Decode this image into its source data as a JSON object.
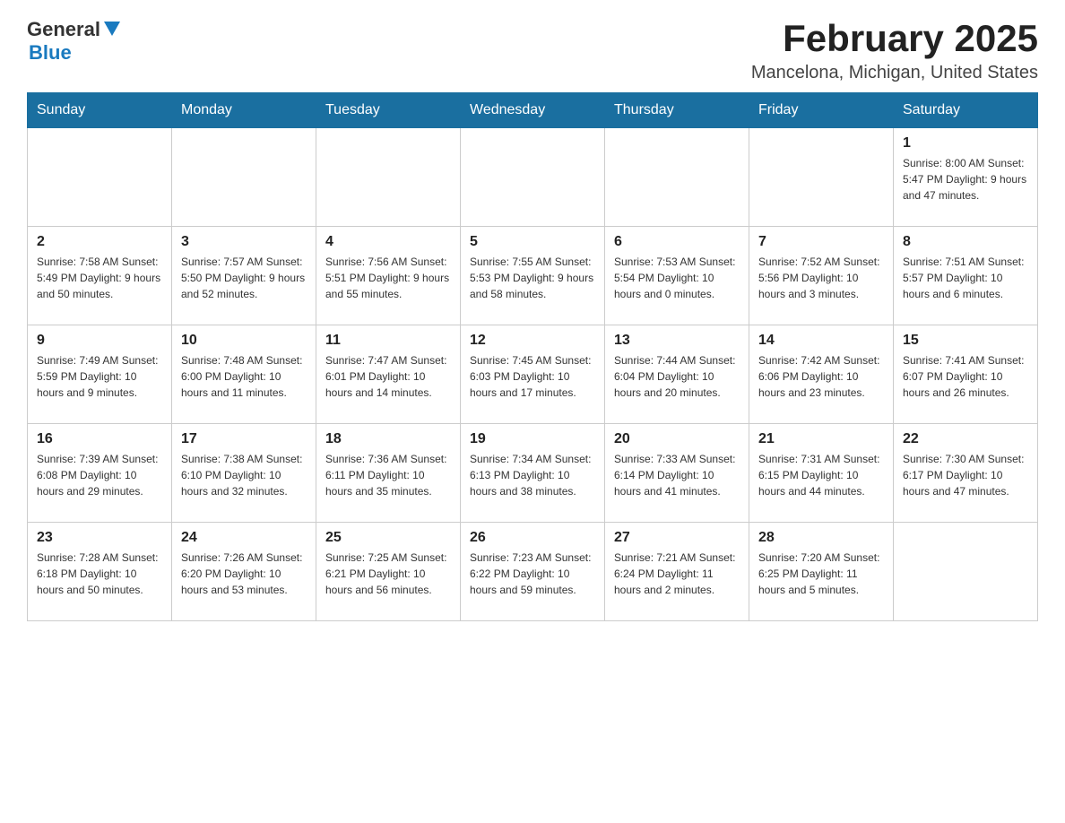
{
  "header": {
    "logo": {
      "general": "General",
      "blue": "Blue"
    },
    "title": "February 2025",
    "location": "Mancelona, Michigan, United States"
  },
  "days_of_week": [
    "Sunday",
    "Monday",
    "Tuesday",
    "Wednesday",
    "Thursday",
    "Friday",
    "Saturday"
  ],
  "weeks": [
    {
      "days": [
        {
          "date": "",
          "info": ""
        },
        {
          "date": "",
          "info": ""
        },
        {
          "date": "",
          "info": ""
        },
        {
          "date": "",
          "info": ""
        },
        {
          "date": "",
          "info": ""
        },
        {
          "date": "",
          "info": ""
        },
        {
          "date": "1",
          "info": "Sunrise: 8:00 AM\nSunset: 5:47 PM\nDaylight: 9 hours and 47 minutes."
        }
      ]
    },
    {
      "days": [
        {
          "date": "2",
          "info": "Sunrise: 7:58 AM\nSunset: 5:49 PM\nDaylight: 9 hours and 50 minutes."
        },
        {
          "date": "3",
          "info": "Sunrise: 7:57 AM\nSunset: 5:50 PM\nDaylight: 9 hours and 52 minutes."
        },
        {
          "date": "4",
          "info": "Sunrise: 7:56 AM\nSunset: 5:51 PM\nDaylight: 9 hours and 55 minutes."
        },
        {
          "date": "5",
          "info": "Sunrise: 7:55 AM\nSunset: 5:53 PM\nDaylight: 9 hours and 58 minutes."
        },
        {
          "date": "6",
          "info": "Sunrise: 7:53 AM\nSunset: 5:54 PM\nDaylight: 10 hours and 0 minutes."
        },
        {
          "date": "7",
          "info": "Sunrise: 7:52 AM\nSunset: 5:56 PM\nDaylight: 10 hours and 3 minutes."
        },
        {
          "date": "8",
          "info": "Sunrise: 7:51 AM\nSunset: 5:57 PM\nDaylight: 10 hours and 6 minutes."
        }
      ]
    },
    {
      "days": [
        {
          "date": "9",
          "info": "Sunrise: 7:49 AM\nSunset: 5:59 PM\nDaylight: 10 hours and 9 minutes."
        },
        {
          "date": "10",
          "info": "Sunrise: 7:48 AM\nSunset: 6:00 PM\nDaylight: 10 hours and 11 minutes."
        },
        {
          "date": "11",
          "info": "Sunrise: 7:47 AM\nSunset: 6:01 PM\nDaylight: 10 hours and 14 minutes."
        },
        {
          "date": "12",
          "info": "Sunrise: 7:45 AM\nSunset: 6:03 PM\nDaylight: 10 hours and 17 minutes."
        },
        {
          "date": "13",
          "info": "Sunrise: 7:44 AM\nSunset: 6:04 PM\nDaylight: 10 hours and 20 minutes."
        },
        {
          "date": "14",
          "info": "Sunrise: 7:42 AM\nSunset: 6:06 PM\nDaylight: 10 hours and 23 minutes."
        },
        {
          "date": "15",
          "info": "Sunrise: 7:41 AM\nSunset: 6:07 PM\nDaylight: 10 hours and 26 minutes."
        }
      ]
    },
    {
      "days": [
        {
          "date": "16",
          "info": "Sunrise: 7:39 AM\nSunset: 6:08 PM\nDaylight: 10 hours and 29 minutes."
        },
        {
          "date": "17",
          "info": "Sunrise: 7:38 AM\nSunset: 6:10 PM\nDaylight: 10 hours and 32 minutes."
        },
        {
          "date": "18",
          "info": "Sunrise: 7:36 AM\nSunset: 6:11 PM\nDaylight: 10 hours and 35 minutes."
        },
        {
          "date": "19",
          "info": "Sunrise: 7:34 AM\nSunset: 6:13 PM\nDaylight: 10 hours and 38 minutes."
        },
        {
          "date": "20",
          "info": "Sunrise: 7:33 AM\nSunset: 6:14 PM\nDaylight: 10 hours and 41 minutes."
        },
        {
          "date": "21",
          "info": "Sunrise: 7:31 AM\nSunset: 6:15 PM\nDaylight: 10 hours and 44 minutes."
        },
        {
          "date": "22",
          "info": "Sunrise: 7:30 AM\nSunset: 6:17 PM\nDaylight: 10 hours and 47 minutes."
        }
      ]
    },
    {
      "days": [
        {
          "date": "23",
          "info": "Sunrise: 7:28 AM\nSunset: 6:18 PM\nDaylight: 10 hours and 50 minutes."
        },
        {
          "date": "24",
          "info": "Sunrise: 7:26 AM\nSunset: 6:20 PM\nDaylight: 10 hours and 53 minutes."
        },
        {
          "date": "25",
          "info": "Sunrise: 7:25 AM\nSunset: 6:21 PM\nDaylight: 10 hours and 56 minutes."
        },
        {
          "date": "26",
          "info": "Sunrise: 7:23 AM\nSunset: 6:22 PM\nDaylight: 10 hours and 59 minutes."
        },
        {
          "date": "27",
          "info": "Sunrise: 7:21 AM\nSunset: 6:24 PM\nDaylight: 11 hours and 2 minutes."
        },
        {
          "date": "28",
          "info": "Sunrise: 7:20 AM\nSunset: 6:25 PM\nDaylight: 11 hours and 5 minutes."
        },
        {
          "date": "",
          "info": ""
        }
      ]
    }
  ]
}
